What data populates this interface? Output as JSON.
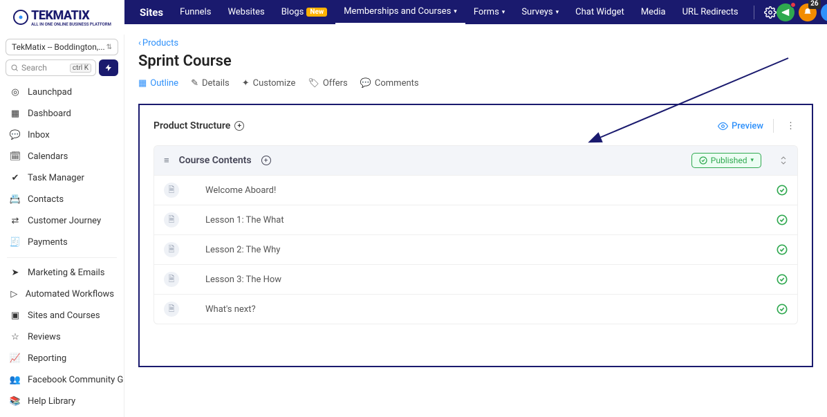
{
  "brand": {
    "name": "TEKMATIX",
    "subtitle": "ALL IN ONE ONLINE BUSINESS PLATFORM"
  },
  "topnav": {
    "items": [
      {
        "label": "Sites",
        "bold": true
      },
      {
        "label": "Funnels"
      },
      {
        "label": "Websites"
      },
      {
        "label": "Blogs",
        "badge": "New"
      },
      {
        "label": "Memberships and Courses",
        "dropdown": true,
        "active": true
      },
      {
        "label": "Forms",
        "dropdown": true
      },
      {
        "label": "Surveys",
        "dropdown": true
      },
      {
        "label": "Chat Widget"
      },
      {
        "label": "Media"
      },
      {
        "label": "URL Redirects"
      }
    ],
    "notification_count": "26"
  },
  "sidebar": {
    "account": "TekMatix -- Boddington,...",
    "search_placeholder": "Search",
    "kbd": "ctrl K",
    "items": [
      {
        "label": "Launchpad"
      },
      {
        "label": "Dashboard"
      },
      {
        "label": "Inbox"
      },
      {
        "label": "Calendars"
      },
      {
        "label": "Task Manager"
      },
      {
        "label": "Contacts"
      },
      {
        "label": "Customer Journey"
      },
      {
        "label": "Payments"
      }
    ],
    "items2": [
      {
        "label": "Marketing & Emails"
      },
      {
        "label": "Automated Workflows"
      },
      {
        "label": "Sites and Courses"
      },
      {
        "label": "Reviews"
      },
      {
        "label": "Reporting"
      },
      {
        "label": "Facebook Community G..."
      },
      {
        "label": "Help Library"
      }
    ]
  },
  "crumb": {
    "back": "Products"
  },
  "page": {
    "title": "Sprint Course"
  },
  "tabs": [
    {
      "label": "Outline",
      "active": true
    },
    {
      "label": "Details"
    },
    {
      "label": "Customize"
    },
    {
      "label": "Offers"
    },
    {
      "label": "Comments"
    }
  ],
  "panel": {
    "heading": "Product Structure",
    "preview": "Preview",
    "module": {
      "title": "Course Contents",
      "status": "Published",
      "lessons": [
        {
          "name": "Welcome Aboard!"
        },
        {
          "name": "Lesson 1: The What"
        },
        {
          "name": "Lesson 2: The Why"
        },
        {
          "name": "Lesson 3: The How"
        },
        {
          "name": "What's next?"
        }
      ]
    }
  }
}
